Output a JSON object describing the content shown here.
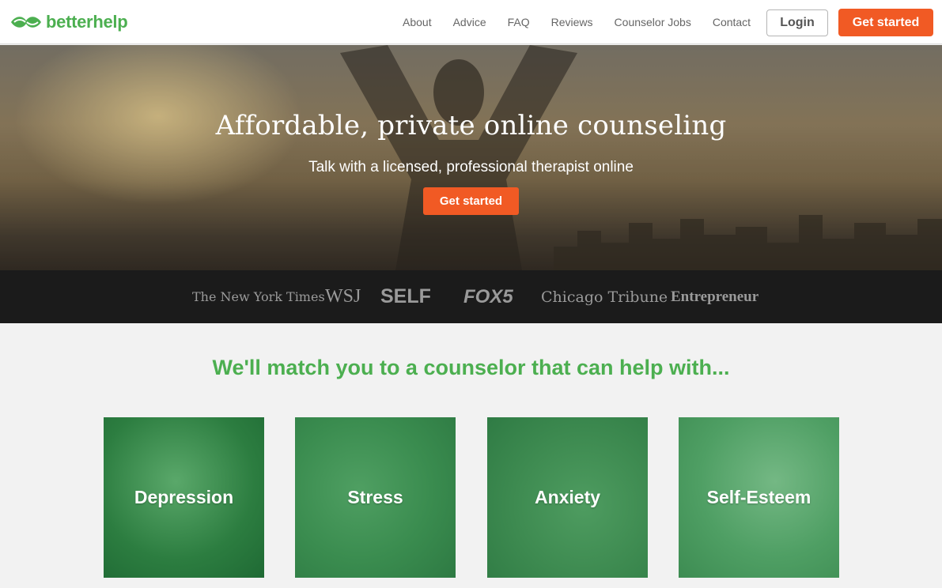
{
  "brand": {
    "name_part1": "better",
    "name_part2": "help",
    "accent_color": "#4caf50",
    "cta_color": "#f15a24",
    "logo_icon": "leaf-logo-icon"
  },
  "nav": {
    "items": [
      "About",
      "Advice",
      "FAQ",
      "Reviews",
      "Counselor Jobs",
      "Contact"
    ],
    "login_label": "Login",
    "get_started_label": "Get started"
  },
  "hero": {
    "title": "Affordable, private online counseling",
    "subtitle": "Talk with a licensed, professional therapist online",
    "cta_label": "Get started"
  },
  "press": {
    "logos": [
      "The New York Times",
      "WSJ",
      "SELF",
      "FOX5",
      "Chicago Tribune",
      "Entrepreneur"
    ]
  },
  "match": {
    "heading": "We'll match you to a counselor that can help with...",
    "topics": [
      "Depression",
      "Stress",
      "Anxiety",
      "Self-Esteem"
    ]
  }
}
